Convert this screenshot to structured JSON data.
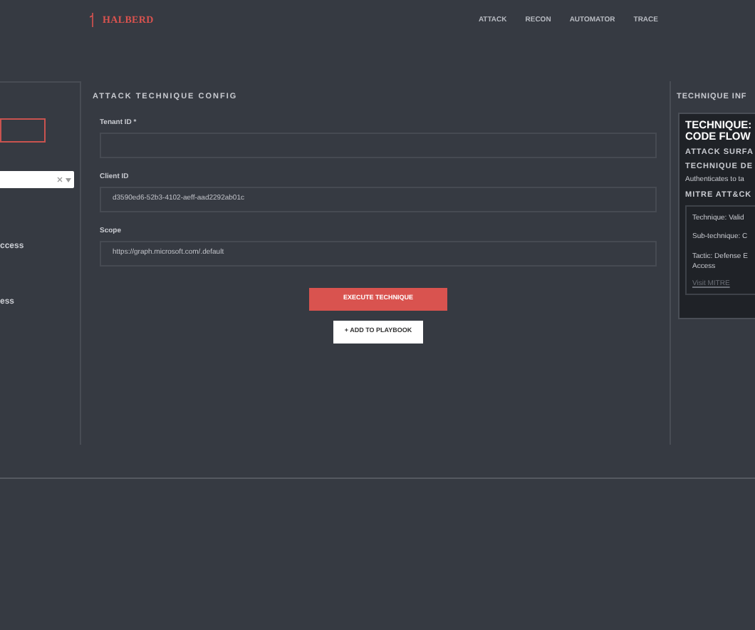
{
  "header": {
    "logo": "HALBERD",
    "nav": [
      {
        "label": "ATTACK",
        "selected": false
      },
      {
        "label": "RECON",
        "selected": false
      },
      {
        "label": "AUTOMATOR",
        "selected": false
      },
      {
        "label": "TRACE",
        "selected": false
      }
    ]
  },
  "left_panel": {
    "search_field": {
      "invalid": true
    },
    "items": [
      "ccess",
      "ess"
    ]
  },
  "config": {
    "title": "ATTACK TECHNIQUE CONFIG",
    "fields": [
      {
        "label": "Tenant ID *"
      },
      {
        "label": "Client ID",
        "value": "d3590ed6-52b3-4102-aeff-aad2292ab01c"
      },
      {
        "label": "Scope",
        "value": "https://graph.microsoft.com/.default"
      }
    ],
    "buttons": [
      {
        "kind": "primary",
        "label": "EXECUTE TECHNIQUE"
      },
      {
        "kind": "secondary",
        "label": "+ ADD TO PLAYBOOK"
      }
    ]
  },
  "info": {
    "title": "TECHNIQUE INF",
    "heading": [
      "TECHNIQUE:",
      "CODE FLOW"
    ],
    "sections": [
      "ATTACK SURFA",
      "TECHNIQUE DE"
    ],
    "description": "Authenticates to ta",
    "mitre_title": "MITRE ATT&CK",
    "mitre_lines": [
      "Technique: Valid",
      "Sub-technique: C",
      "Tactic: Defense E",
      "Access"
    ],
    "link": "Visit MITRE"
  }
}
